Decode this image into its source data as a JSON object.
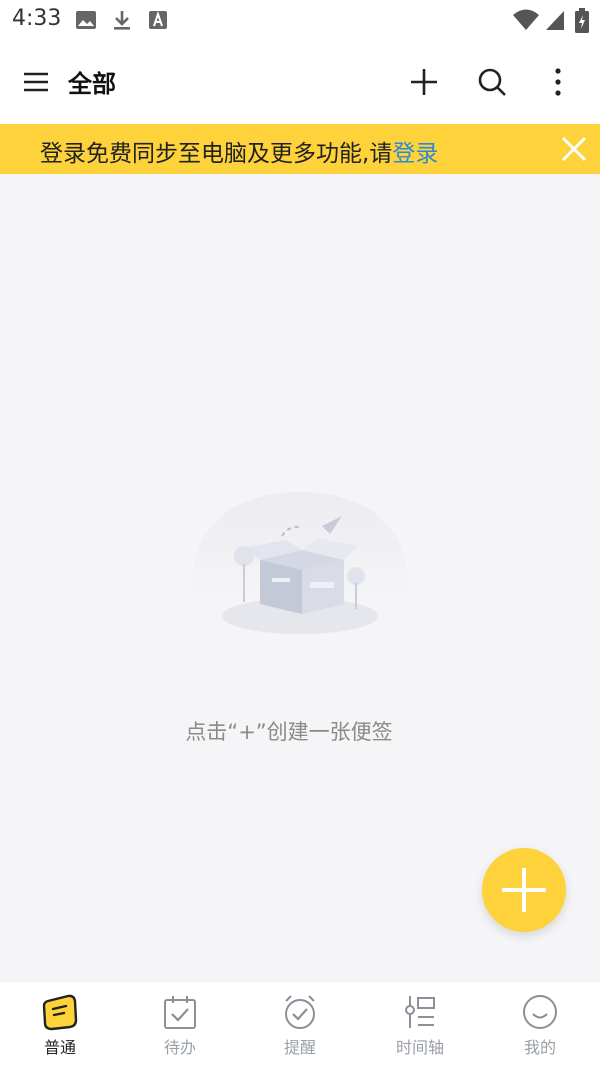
{
  "status_bar": {
    "time": "4:33"
  },
  "app_bar": {
    "title": "全部"
  },
  "banner": {
    "text": "登录免费同步至电脑及更多功能,请",
    "link": "登录"
  },
  "empty_state": {
    "message": "点击“+”创建一张便签"
  },
  "tabs": [
    {
      "label": "普通",
      "icon": "note-icon",
      "active": true
    },
    {
      "label": "待办",
      "icon": "calendar-check-icon",
      "active": false
    },
    {
      "label": "提醒",
      "icon": "alarm-clock-icon",
      "active": false
    },
    {
      "label": "时间轴",
      "icon": "timeline-icon",
      "active": false
    },
    {
      "label": "我的",
      "icon": "smiley-icon",
      "active": false
    }
  ],
  "colors": {
    "accent": "#fdd23a",
    "link": "#2a8bd8",
    "background": "#f5f5f7"
  }
}
